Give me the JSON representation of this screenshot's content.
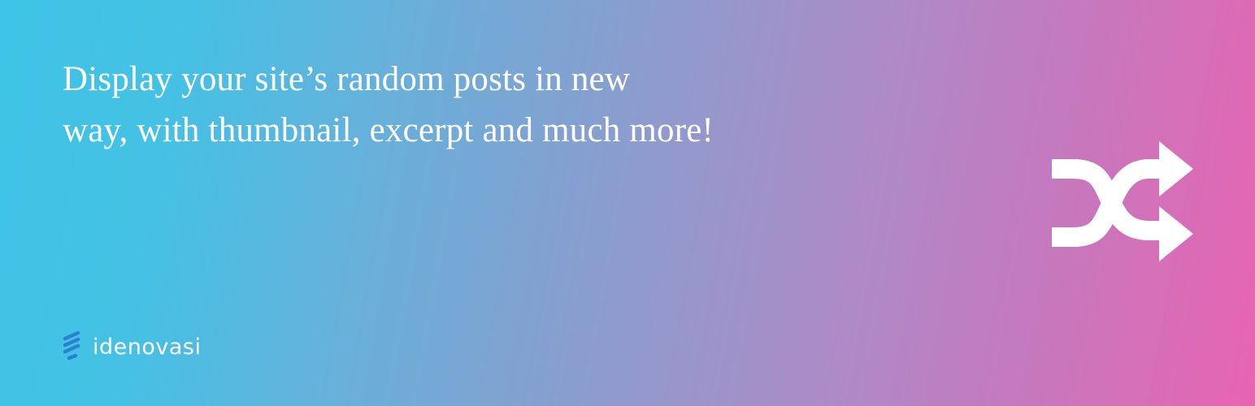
{
  "headline": {
    "line1": "Display your site’s random posts in new",
    "line2": "way, with thumbnail, excerpt and much more!"
  },
  "icons": {
    "shuffle": "shuffle-icon",
    "brand": "lightbulb-logo-icon"
  },
  "brand": {
    "name": "idenovasi"
  },
  "colors": {
    "gradient_start": "#3ec4e6",
    "gradient_end": "#e864b2",
    "text": "#ffffff",
    "logo_mark": "#2f7fd0"
  }
}
